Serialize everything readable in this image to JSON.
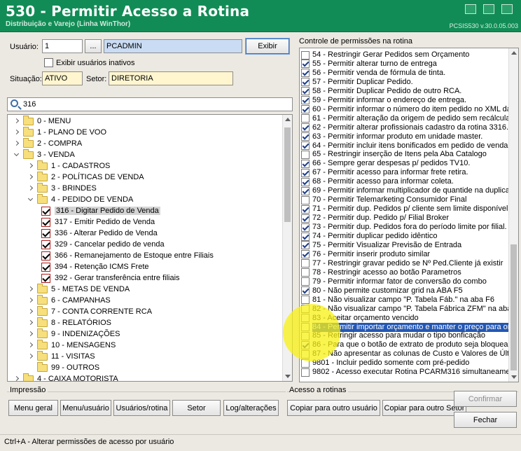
{
  "header": {
    "title": "530 - Permitir Acesso a Rotina",
    "subtitle": "Distribuição e Varejo (Linha WinThor)",
    "version": "PCSIS530 v.30.0.05.003"
  },
  "form": {
    "usuario_label": "Usuário:",
    "usuario_code": "1",
    "usuario_lookup": "...",
    "usuario_name": "PCADMIN",
    "exibir_label": "Exibir",
    "exibir_inativos_label": "Exibir usuários inativos",
    "situacao_label": "Situação:",
    "situacao_value": "ATIVO",
    "setor_label": "Setor:",
    "setor_value": "DIRETORIA"
  },
  "search": {
    "query": "316"
  },
  "tree": {
    "items": [
      {
        "label": "0 - MENU",
        "level": 0,
        "kind": "folder",
        "state": "collapsed"
      },
      {
        "label": "1 - PLANO DE VOO",
        "level": 0,
        "kind": "folder",
        "state": "collapsed"
      },
      {
        "label": "2 - COMPRA",
        "level": 0,
        "kind": "folder",
        "state": "collapsed"
      },
      {
        "label": "3 - VENDA",
        "level": 0,
        "kind": "folder",
        "state": "expanded"
      },
      {
        "label": "1 - CADASTROS",
        "level": 1,
        "kind": "folder",
        "state": "collapsed"
      },
      {
        "label": "2 - POLÍTICAS DE VENDA",
        "level": 1,
        "kind": "folder",
        "state": "collapsed"
      },
      {
        "label": "3 - BRINDES",
        "level": 1,
        "kind": "folder",
        "state": "collapsed"
      },
      {
        "label": "4 - PEDIDO DE VENDA",
        "level": 1,
        "kind": "folder",
        "state": "expanded"
      },
      {
        "label": "316 - Digitar Pedido de Venda",
        "level": 2,
        "kind": "check",
        "selected": true
      },
      {
        "label": "317 - Emitir Pedido de Venda",
        "level": 2,
        "kind": "check"
      },
      {
        "label": "336 - Alterar Pedido de Venda",
        "level": 2,
        "kind": "check"
      },
      {
        "label": "329 - Cancelar pedido de venda",
        "level": 2,
        "kind": "check"
      },
      {
        "label": "366 - Remanejamento de Estoque entre Filiais",
        "level": 2,
        "kind": "check"
      },
      {
        "label": "394 - Retenção ICMS Frete",
        "level": 2,
        "kind": "check"
      },
      {
        "label": "392 - Gerar transferência entre filiais",
        "level": 2,
        "kind": "check"
      },
      {
        "label": "5 - METAS DE VENDA",
        "level": 1,
        "kind": "folder",
        "state": "collapsed"
      },
      {
        "label": "6 - CAMPANHAS",
        "level": 1,
        "kind": "folder",
        "state": "collapsed"
      },
      {
        "label": "7 - CONTA CORRENTE RCA",
        "level": 1,
        "kind": "folder",
        "state": "collapsed"
      },
      {
        "label": "8 - RELATÓRIOS",
        "level": 1,
        "kind": "folder",
        "state": "collapsed"
      },
      {
        "label": "9 - INDENIZAÇÕES",
        "level": 1,
        "kind": "folder",
        "state": "collapsed"
      },
      {
        "label": "10 - MENSAGENS",
        "level": 1,
        "kind": "folder",
        "state": "collapsed"
      },
      {
        "label": "11 - VISITAS",
        "level": 1,
        "kind": "folder",
        "state": "collapsed"
      },
      {
        "label": "99 - OUTROS",
        "level": 1,
        "kind": "folder",
        "state": "none"
      },
      {
        "label": "4 - CAIXA MOTORISTA",
        "level": 0,
        "kind": "folder",
        "state": "collapsed"
      }
    ]
  },
  "impressao": {
    "title": "Impressão",
    "buttons": [
      "Menu geral",
      "Menu/usuário",
      "Usuários/rotina",
      "Setor",
      "Log/alterações"
    ]
  },
  "acesso": {
    "title": "Acesso a rotinas",
    "copy_user": "Copiar para outro usuário",
    "copy_sector": "Copiar para outro Setor"
  },
  "actions": {
    "confirm": "Confirmar",
    "close": "Fechar"
  },
  "permissions": {
    "title": "Controle de permissões na rotina",
    "items": [
      {
        "label": "54 - Restringir Gerar Pedidos sem Orçamento",
        "checked": false
      },
      {
        "label": "55 - Permitir alterar turno de entrega",
        "checked": true
      },
      {
        "label": "56 - Permitir venda de fórmula de tinta.",
        "checked": true
      },
      {
        "label": "57 - Permitir Duplicar Pedido.",
        "checked": true
      },
      {
        "label": "58 - Permitir Duplicar Pedido de outro RCA.",
        "checked": true
      },
      {
        "label": "59 - Permitir informar o endereço de entrega.",
        "checked": true
      },
      {
        "label": "60 - Permitir informar o número do item pedido no XML da n",
        "checked": true
      },
      {
        "label": "61 - Permitir alteração da origem de pedido sem recálcular",
        "checked": false
      },
      {
        "label": "62 - Permitir alterar profissionais cadastro da rotina 3316.",
        "checked": true
      },
      {
        "label": "63 - Permitir informar produto em unidade master.",
        "checked": true
      },
      {
        "label": "64 - Permitir incluir itens bonificados em pedido de venda",
        "checked": true
      },
      {
        "label": "65 - Restringir inserção de Itens pela Aba Catalogo",
        "checked": false
      },
      {
        "label": "66 - Sempre gerar despesas p/ pedidos TV10.",
        "checked": true
      },
      {
        "label": "67 - Permitir acesso para informar frete retira.",
        "checked": true
      },
      {
        "label": "68 - Permitir acesso para informar coleta.",
        "checked": true
      },
      {
        "label": "69 - Permitir informar multiplicador de quantide na duplicaç",
        "checked": true
      },
      {
        "label": "70 - Permitir Telemarketing Consumidor Final",
        "checked": false
      },
      {
        "label": "71 - Permitir dup. Pedidos p/ cliente sem limite disponível",
        "checked": true
      },
      {
        "label": "72 - Permitir dup. Pedido p/ Filial Broker",
        "checked": true
      },
      {
        "label": "73 - Permitir dup. Pedidos fora do período limite por filial.",
        "checked": true
      },
      {
        "label": "74 - Permitir duplicar pedido idêntico",
        "checked": true
      },
      {
        "label": "75 - Permitir Visualizar Previsão de Entrada",
        "checked": true
      },
      {
        "label": "76 - Permitir inserir produto similar",
        "checked": true
      },
      {
        "label": "77 - Restringir gravar pedido se Nº Ped.Cliente já existir",
        "checked": false
      },
      {
        "label": "78 - Restringir acesso ao botão Parametros",
        "checked": false
      },
      {
        "label": "79 - Permitir informar fator de conversão do combo",
        "checked": false
      },
      {
        "label": "80 - Não permite customizar grid na ABA F5",
        "checked": true
      },
      {
        "label": "81 - Não visualizar campo \"P. Tabela Fáb.\" na aba F6",
        "checked": false
      },
      {
        "label": "82 - Não visualizar campo \"P. Tabela Fábrica ZFM\" na aba I",
        "checked": false
      },
      {
        "label": "83 - Aceitar orçamento vencido",
        "checked": false
      },
      {
        "label": "84 - Permitir importar orçamento e manter o preço para orc",
        "checked": false,
        "highlighted": true
      },
      {
        "label": "85 - Retringir acesso para mudar o tipo bonficação",
        "checked": false
      },
      {
        "label": "86 - Para que o botão de extrato de produto seja bloquea",
        "checked": true
      },
      {
        "label": "87 - Não apresentar as colunas de Custo e Valores de Últir",
        "checked": false
      },
      {
        "label": "9801 - Incluir pedido somente com pré-pedido",
        "checked": false
      },
      {
        "label": "9802 - Acesso executar Rotina PCARM316 simultaneamen",
        "checked": false
      }
    ]
  },
  "status": {
    "text": "Ctrl+A - Alterar permissões de acesso por usuário"
  }
}
